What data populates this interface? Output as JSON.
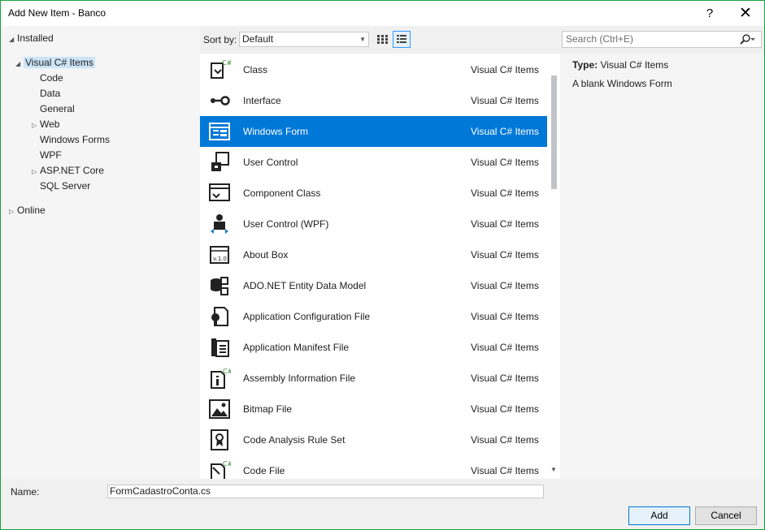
{
  "window": {
    "title": "Add New Item - Banco",
    "help": "?",
    "close": "✕"
  },
  "tree": [
    {
      "label": "Installed",
      "arrow": "◢",
      "level": 0
    },
    {
      "label": "Visual C# Items",
      "arrow": "◢",
      "level": 1,
      "selected": true
    },
    {
      "label": "Code",
      "arrow": "",
      "level": 2
    },
    {
      "label": "Data",
      "arrow": "",
      "level": 2
    },
    {
      "label": "General",
      "arrow": "",
      "level": 2
    },
    {
      "label": "Web",
      "arrow": "▷",
      "level": 2
    },
    {
      "label": "Windows Forms",
      "arrow": "",
      "level": 2
    },
    {
      "label": "WPF",
      "arrow": "",
      "level": 2
    },
    {
      "label": "ASP.NET Core",
      "arrow": "▷",
      "level": 2
    },
    {
      "label": "SQL Server",
      "arrow": "",
      "level": 2
    },
    {
      "label": "Online",
      "arrow": "▷",
      "level": 0
    }
  ],
  "toolbar": {
    "sort_label": "Sort by:",
    "sort_value": "Default",
    "search_placeholder": "Search (Ctrl+E)"
  },
  "items": [
    {
      "name": "Class",
      "category": "Visual C# Items",
      "icon": "class-icon"
    },
    {
      "name": "Interface",
      "category": "Visual C# Items",
      "icon": "interface-icon"
    },
    {
      "name": "Windows Form",
      "category": "Visual C# Items",
      "icon": "windows-form-icon",
      "selected": true
    },
    {
      "name": "User Control",
      "category": "Visual C# Items",
      "icon": "user-control-icon"
    },
    {
      "name": "Component Class",
      "category": "Visual C# Items",
      "icon": "component-class-icon"
    },
    {
      "name": "User Control (WPF)",
      "category": "Visual C# Items",
      "icon": "user-control-wpf-icon"
    },
    {
      "name": "About Box",
      "category": "Visual C# Items",
      "icon": "about-box-icon"
    },
    {
      "name": "ADO.NET Entity Data Model",
      "category": "Visual C# Items",
      "icon": "entity-data-model-icon"
    },
    {
      "name": "Application Configuration File",
      "category": "Visual C# Items",
      "icon": "config-file-icon"
    },
    {
      "name": "Application Manifest File",
      "category": "Visual C# Items",
      "icon": "manifest-file-icon"
    },
    {
      "name": "Assembly Information File",
      "category": "Visual C# Items",
      "icon": "assembly-info-icon"
    },
    {
      "name": "Bitmap File",
      "category": "Visual C# Items",
      "icon": "bitmap-file-icon"
    },
    {
      "name": "Code Analysis Rule Set",
      "category": "Visual C# Items",
      "icon": "rule-set-icon"
    },
    {
      "name": "Code File",
      "category": "Visual C# Items",
      "icon": "code-file-icon"
    }
  ],
  "details": {
    "type_label": "Type:",
    "type_value": "Visual C# Items",
    "description": "A blank Windows Form"
  },
  "footer": {
    "name_label": "Name:",
    "name_value": "FormCadastroConta.cs",
    "add_label": "Add",
    "cancel_label": "Cancel"
  }
}
